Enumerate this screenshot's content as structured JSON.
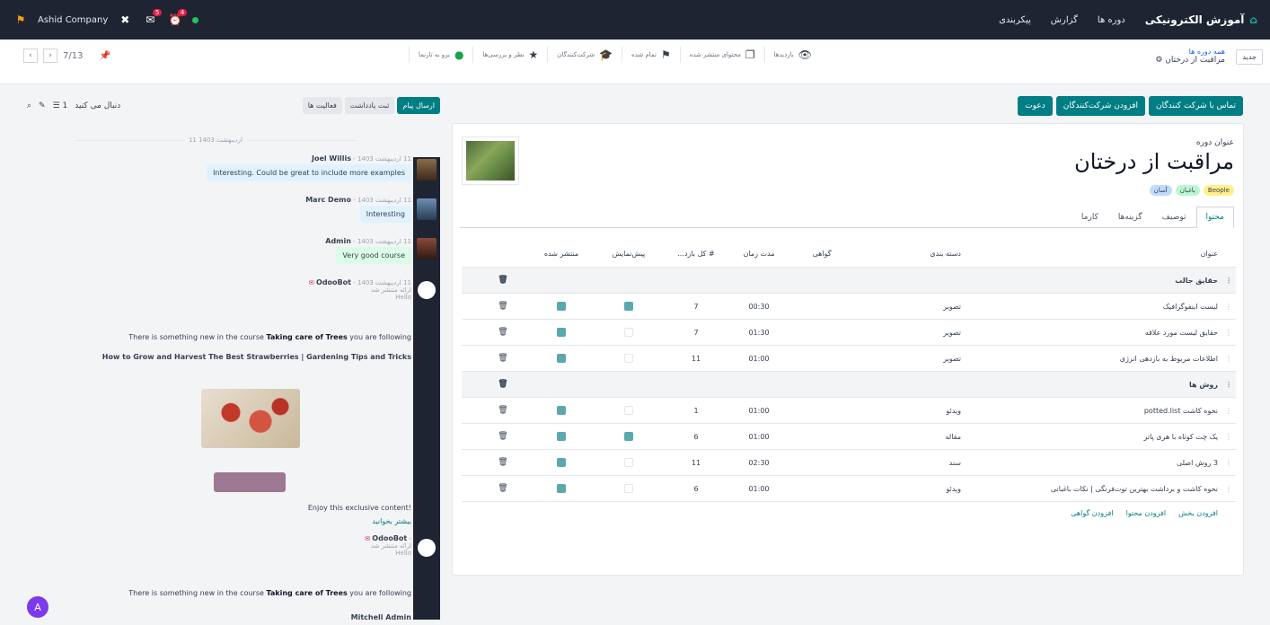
{
  "navbar": {
    "app_name": "آموزش الکترونیکی",
    "menu": [
      "دوره ها",
      "گزارش",
      "پیکربندی"
    ],
    "company": "Ashid Company",
    "notif_count": "5",
    "activity_count": "4"
  },
  "control": {
    "pager": "7/13",
    "breadcrumb_parent": "همه دوره ها",
    "breadcrumb_current": "مراقبت از درختان",
    "new_label": "جدید",
    "stats": [
      {
        "icon": "eye-icon",
        "text": "بازدیدها"
      },
      {
        "icon": "content-icon",
        "text": "محتوای منتشر شده"
      },
      {
        "icon": "flag-icon",
        "text": "تمام شده"
      },
      {
        "icon": "graduation-cap-icon",
        "text": "شرکت‌کنندگان"
      },
      {
        "icon": "star-icon",
        "text": "نظر و بررسی‌ها"
      },
      {
        "icon": "globe-icon",
        "text": "برو به تارنما"
      }
    ]
  },
  "actions": [
    "تماس با شرکت کنندگان",
    "افزودن شرکت‌کنندگان",
    "دعوت"
  ],
  "form": {
    "title_label": "عنوان دوره",
    "title": "مراقبت از درختان",
    "tags": [
      {
        "label": "Beople",
        "color": "#fef08a"
      },
      {
        "label": "باغبان",
        "color": "#bbf7d0"
      },
      {
        "label": "آسان",
        "color": "#bfdbfe"
      }
    ],
    "tabs": [
      "محتوا",
      "توصیف",
      "گزینه‌ها",
      "کارما"
    ]
  },
  "table": {
    "headers": [
      "عنوان",
      "دسته بندی",
      "گواهی",
      "مدت زمان",
      "# کل بازد...",
      "پیش‌نمایش",
      "منتشر شده"
    ],
    "rows": [
      {
        "section": true,
        "title": "حقایق جالب"
      },
      {
        "title": "لیست اینفوگرافیک",
        "cat": "تصویر",
        "dur": "00:30",
        "views": "7",
        "preview": true,
        "pub": true
      },
      {
        "title": "حقایق لیست مورد علاقه",
        "cat": "تصویر",
        "dur": "01:30",
        "views": "7",
        "preview": false,
        "pub": true
      },
      {
        "title": "اطلاعات مربوط به بازدهی انرژی",
        "cat": "تصویر",
        "dur": "01:00",
        "views": "11",
        "preview": false,
        "pub": true
      },
      {
        "section": true,
        "title": "روش ها"
      },
      {
        "title": "نحوه کاشت potted.list",
        "cat": "ویدئو",
        "dur": "01:00",
        "views": "1",
        "preview": false,
        "pub": true
      },
      {
        "title": "یک چت کوتاه با هری پاتر",
        "cat": "مقاله",
        "dur": "01:00",
        "views": "6",
        "preview": true,
        "pub": true
      },
      {
        "title": "3 روش اصلی",
        "cat": "سند",
        "dur": "02:30",
        "views": "11",
        "preview": false,
        "pub": true
      },
      {
        "title": "نحوه کاشت و برداشت بهترین توت‌فرنگی | نکات باغبانی",
        "cat": "ویدئو",
        "dur": "01:00",
        "views": "6",
        "preview": false,
        "pub": true
      }
    ],
    "add_links": [
      "افزودن بخش",
      "افزودن محتوا",
      "افزودن گواهی"
    ]
  },
  "chatter": {
    "buttons": [
      "ارسال پیام",
      "ثبت یادداشت",
      "فعالیت ها"
    ],
    "follow": "دنبال می کنید",
    "follower_count": "1",
    "date": "11 اردیبهشت 1403",
    "messages": [
      {
        "author": "Joel Willis",
        "time": "11 اردیبهشت 1403",
        "text": "Interesting. Could be great to include more examples",
        "style": "blue"
      },
      {
        "author": "Marc Demo",
        "time": "11 اردیبهشت 1403",
        "text": "Interesting",
        "style": "blue"
      },
      {
        "author": "Admin",
        "time": "11 اردیبهشت 1403",
        "text": "Very good course",
        "style": "green"
      }
    ],
    "notif": {
      "author": "OdooBot",
      "time": "11 اردیبهشت 1403",
      "status": "ارائه منتشر شد",
      "sub": "Hello",
      "line1_pre": "There is something new in the course ",
      "line1_course": "Taking care of Trees",
      "line1_post": " you are following",
      "headline": "How to Grow and Harvest The Best Strawberries | Gardening Tips and Tricks",
      "enjoy": "Enjoy this exclusive content!",
      "more": "بیشتر بخوانید"
    },
    "notif2_line": "There is something new in the course ",
    "notif2_course": "Taking care of Trees",
    "notif2_post": " you are following",
    "notif2_author": "OdooBot",
    "notif2_status": "ارائه منتشر شد",
    "notif2_sub": "Hello",
    "footer_name": "Mitchell Admin",
    "user_initial": "A"
  }
}
